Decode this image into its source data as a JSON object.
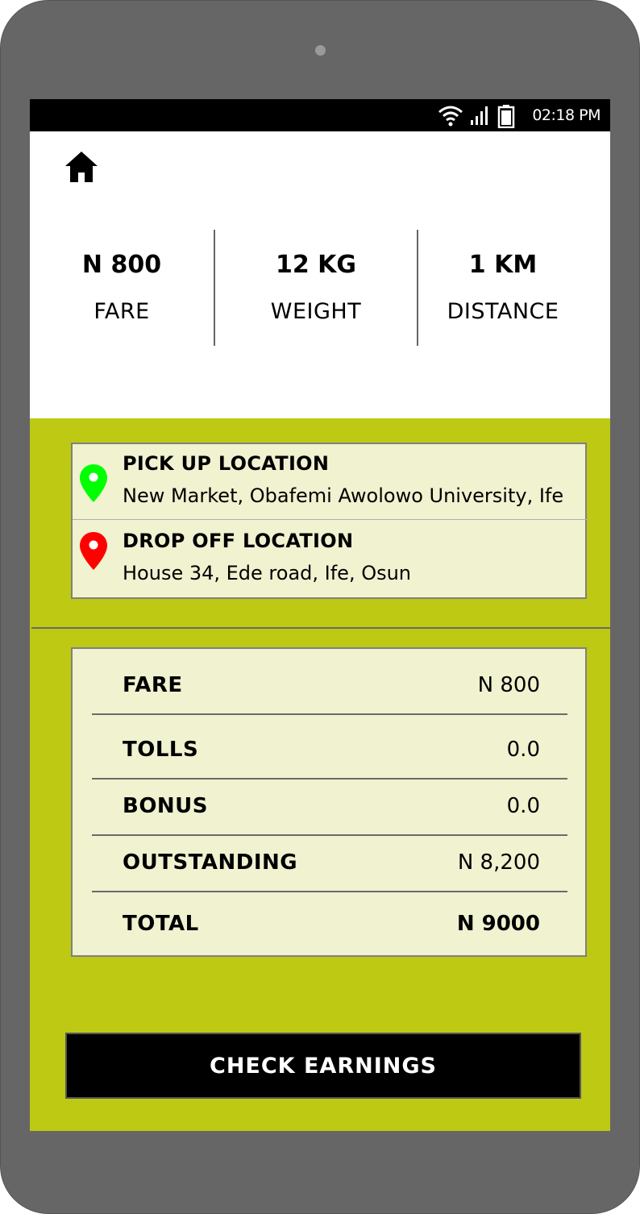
{
  "status_bar": {
    "time": "02:18 PM",
    "icons": [
      "wifi-icon",
      "signal-icon",
      "battery-icon"
    ]
  },
  "header": {
    "home_icon": "home-icon"
  },
  "summary": {
    "fare": {
      "value": "N 800",
      "label": "FARE"
    },
    "weight": {
      "value": "12 KG",
      "label": "WEIGHT"
    },
    "distance": {
      "value": "1 KM",
      "label": "DISTANCE"
    }
  },
  "locations": {
    "pickup": {
      "title": "PICK UP LOCATION",
      "address": "New Market, Obafemi Awolowo University, Ife",
      "pin_color": "#00ff00"
    },
    "dropoff": {
      "title": "DROP OFF LOCATION",
      "address": "House 34, Ede road, Ife, Osun",
      "pin_color": "#ff0000"
    }
  },
  "breakdown": {
    "rows": [
      {
        "label": "FARE",
        "value": "N 800"
      },
      {
        "label": "TOLLS",
        "value": "0.0"
      },
      {
        "label": "BONUS",
        "value": "0.0"
      },
      {
        "label": "OUTSTANDING",
        "value": "N 8,200"
      },
      {
        "label": "TOTAL",
        "value": "N 9000"
      }
    ]
  },
  "actions": {
    "check_earnings_label": "CHECK EARNINGS"
  },
  "colors": {
    "accent": "#bdc912",
    "card": "#f0f2d0",
    "device": "#666666"
  }
}
